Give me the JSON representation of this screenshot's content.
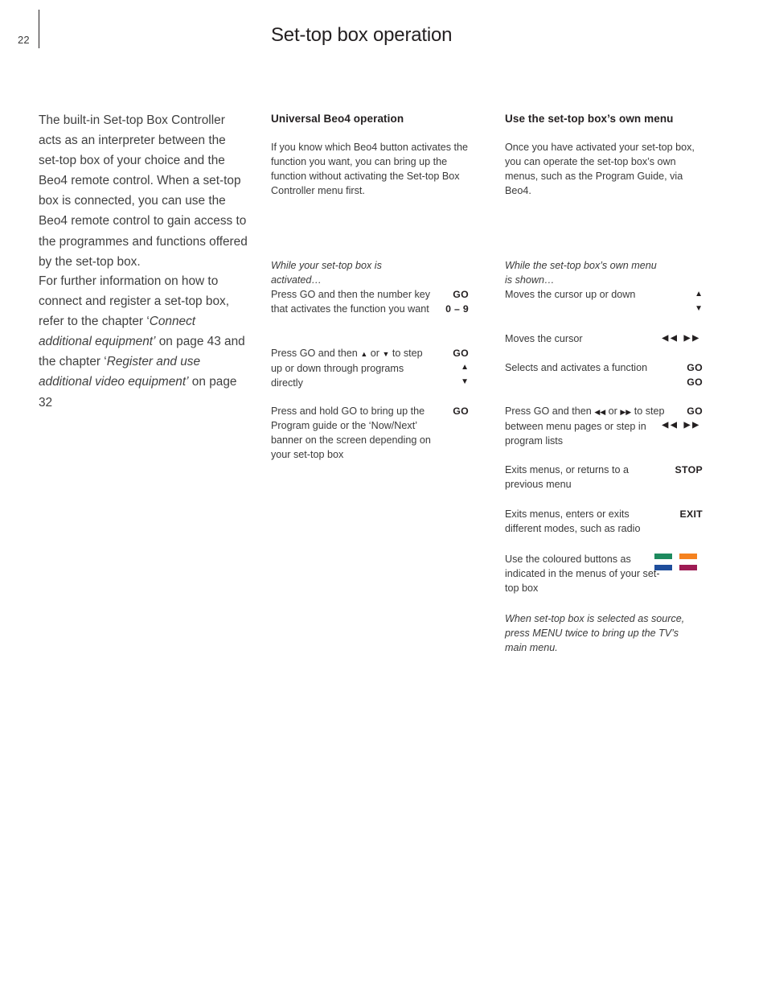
{
  "header": {
    "page_number": "22",
    "title": "Set-top box operation"
  },
  "left_column": {
    "paragraph_1": "The built-in Set-top Box Controller acts as an interpreter between the set-top box of your choice and the Beo4 remote control. When a set-top box is connected, you can use the Beo4 remote control to gain access to the programmes and functions offered by the set-top box.",
    "paragraph_2_part_1": "For further information on how to connect and register a set-top box, refer to the chapter ‘",
    "paragraph_2_italic_1": "Connect additional equipment’",
    "paragraph_2_part_2": " on page 43 and the chapter ‘",
    "paragraph_2_italic_2": "Register and use additional video equipment’",
    "paragraph_2_part_3": " on page 32"
  },
  "middle_column": {
    "heading": "Universal Beo4 operation",
    "intro": "If you know which Beo4 button activates the function you want, you can bring up the function without activating the Set-top Box Controller menu first.",
    "section_intro": "While your set-top box is activated…",
    "rows": [
      {
        "desc_part_1": "Press GO and then the number key that activates the function you want",
        "keys": [
          "GO",
          "0 – 9"
        ]
      },
      {
        "desc_part_1": "Press GO and then ",
        "glyph_1": "▲",
        "desc_part_2": " or ",
        "glyph_2": "▼",
        "desc_part_3": " to step up or down through programs directly",
        "keys": [
          "GO",
          "▲",
          "▼"
        ]
      },
      {
        "desc_part_1": "Press and hold GO to bring up the Program guide or the ‘Now/Next’ banner on the screen depending on your set-top box",
        "keys": [
          "GO"
        ]
      }
    ]
  },
  "right_column": {
    "heading": "Use the set-top box’s own menu",
    "intro": "Once you have activated your set-top box, you can operate the set-top box’s own menus, such as the Program Guide, via Beo4.",
    "section_intro": "While the set-top box’s own menu is shown…",
    "rows": [
      {
        "desc_part_1": "Moves the cursor up or down",
        "keys": [
          "▲",
          "▼"
        ]
      },
      {
        "desc_part_1": "Moves the cursor",
        "keys": [
          "◀◀  ▶▶"
        ]
      },
      {
        "desc_part_1": "Selects and activates a function",
        "keys": [
          "GO",
          "GO"
        ]
      },
      {
        "desc_part_1": "Press GO and then ",
        "glyph_1": "◀◀",
        "desc_part_2": " or ",
        "glyph_2": "▶▶",
        "desc_part_3": " to step between menu pages or step in program lists",
        "keys": [
          "GO",
          "◀◀  ▶▶"
        ]
      },
      {
        "desc_part_1": "Exits menus, or returns to a previous menu",
        "keys": [
          "STOP"
        ]
      },
      {
        "desc_part_1": "Exits menus, enters or exits different modes, such as radio",
        "keys": [
          "EXIT"
        ]
      }
    ],
    "colour_row": {
      "desc": "Use the coloured buttons as indicated in the menus of your set-top box",
      "colours": [
        "#1d8a5e",
        "#f5821f",
        "#1f4e9c",
        "#9e1b54"
      ]
    },
    "footnote": "When set-top box is selected as source, press MENU twice to bring up the TV’s main menu."
  }
}
